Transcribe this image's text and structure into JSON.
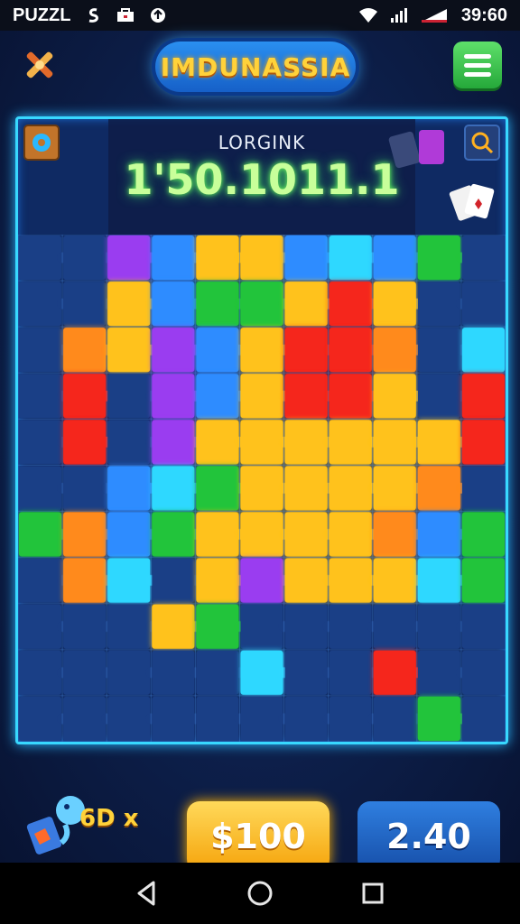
{
  "statusbar": {
    "app_label": "PUZZL",
    "time": "39:60",
    "icons": [
      "notification-s-icon",
      "briefcase-icon",
      "upload-icon",
      "wifi-icon",
      "signal-icon",
      "battery-icon"
    ]
  },
  "header": {
    "title": "IMDUNASSIA",
    "left_icon": "crossed-tools-icon",
    "right_icon": "menu-icon"
  },
  "score": {
    "label": "LORGINK",
    "value": "1'50.1011.1"
  },
  "board": {
    "corner_icons": [
      "gear-badge-icon",
      "cards-icon",
      "search-icon",
      "playing-cards-icon"
    ],
    "cols": 11,
    "rows": 11,
    "colors": {
      "R": "#f5261a",
      "O": "#ff8a1a",
      "Y": "#ffc21a",
      "G": "#22c43a",
      "B": "#2d8cff",
      "P": "#9a3df0",
      "C": "#2fd8ff",
      "D": "#1a3f86"
    },
    "tiles": [
      "DDPBYYBCBGD",
      "DDYBGGYRYDD",
      "DOYPBYRRODC",
      "DRDPBYRRYDR",
      "DRDPYYYYYYR",
      "DDBCGYYYYOD",
      "GOBGYYYYOBG",
      "DOCDYPYYYCG",
      "DDDYGDDDDDD",
      "DDDDDCDDRDD",
      "DDDDDDDDDGD"
    ]
  },
  "footer": {
    "mascot_icon": "fish-mascot-icon",
    "multiplier": "6D x",
    "price": "$100",
    "value": "2.40"
  },
  "navbar": {
    "icons": [
      "back-icon",
      "home-icon",
      "recents-icon"
    ]
  }
}
